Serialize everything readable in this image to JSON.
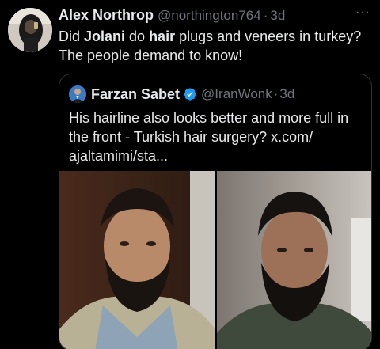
{
  "tweet": {
    "author_name": "Alex Northrop",
    "author_handle": "@northington764",
    "separator": "·",
    "time": "3d",
    "more_label": "···",
    "text_parts": [
      "Did ",
      "Jolani",
      " do ",
      "hair",
      " plugs and veneers in turkey? The people demand to know!"
    ]
  },
  "quoted": {
    "author_name": "Farzan Sabet",
    "author_handle": "@IranWonk",
    "separator": "·",
    "time": "3d",
    "text": "His hairline also looks better and more full in the front - Turkish hair surgery? x.com/ ajaltamimi/sta...",
    "verified_color": "#1d9bf0"
  },
  "colors": {
    "background": "#000000",
    "text": "#e7e9ea",
    "muted": "#71767b",
    "border": "#2f3336"
  }
}
